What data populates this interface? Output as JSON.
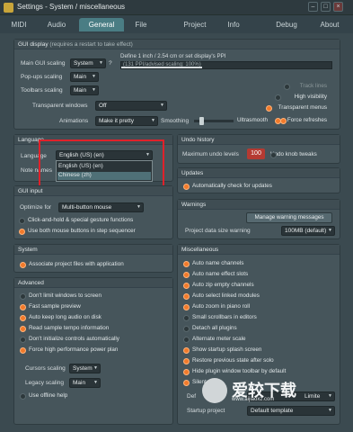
{
  "window": {
    "title": "Settings - System / miscellaneous",
    "min": "–",
    "max": "□",
    "close": "×"
  },
  "tabs": [
    "MIDI",
    "Audio",
    "General",
    "File",
    "Project",
    "Info",
    "Debug",
    "About"
  ],
  "gui_display": {
    "header": "GUI display",
    "header_note": "(requires a restart to take effect)",
    "main_gui_label": "Main GUI scaling",
    "main_gui_value": "System",
    "help": "?",
    "define_label": "Define 1 inch / 2.54 cm or set display's PPI",
    "ppi_text": "(131 PPI/advised scaling: 100%)",
    "popups_label": "Pop-ups scaling",
    "popups_value": "Main",
    "toolbars_label": "Toolbars scaling",
    "toolbars_value": "Main",
    "transparent_label": "Transparent windows",
    "transparent_value": "Off",
    "animations_label": "Animations",
    "animations_value": "Make it pretty",
    "smoothing_label": "Smoothing",
    "right_opts": [
      {
        "label": "Track lines",
        "on": false
      },
      {
        "label": "High visibility",
        "on": false
      },
      {
        "label": "Transparent menus",
        "on": true
      },
      {
        "label": "Force refreshes",
        "on": true
      }
    ],
    "ultrasmooth": {
      "label": "Ultrasmooth",
      "on": true
    }
  },
  "language": {
    "header": "Language",
    "label": "Language",
    "value": "English (US) (en)",
    "note": "Note names",
    "options": [
      "English (US) (en)",
      "Chinese (zh)"
    ]
  },
  "history": {
    "header": "Undo history",
    "max_label": "Maximum undo levels",
    "max_value": "100",
    "knob": {
      "label": "Undo knob tweaks",
      "on": false
    }
  },
  "updates": {
    "header": "Updates",
    "auto": "Automatically check for updates"
  },
  "gui_input": {
    "header": "GUI input",
    "optimize_label": "Optimize for",
    "optimize_value": "Multi-button mouse",
    "opts": [
      {
        "label": "Click-and-hold & special gesture functions",
        "on": false
      },
      {
        "label": "Use both mouse buttons in step sequencer",
        "on": true
      }
    ]
  },
  "warnings": {
    "header": "Warnings",
    "manage": "Manage warning messages",
    "limit_label": "Project data size warning",
    "limit_value": "100MB (default)"
  },
  "system": {
    "header": "System",
    "assoc": "Associate project files with application"
  },
  "advanced": {
    "header": "Advanced",
    "opts": [
      {
        "label": "Don't limit windows to screen",
        "on": false
      },
      {
        "label": "Fast sample preview",
        "on": true
      },
      {
        "label": "Auto keep long audio on disk",
        "on": true
      },
      {
        "label": "Read sample tempo information",
        "on": true
      },
      {
        "label": "Don't initialize controls automatically",
        "on": false
      },
      {
        "label": "Force high performance power plan",
        "on": true
      }
    ],
    "cursors_label": "Cursors scaling",
    "cursors_value": "System",
    "legacy_label": "Legacy scaling",
    "legacy_value": "Main",
    "offline": {
      "label": "Use offline help",
      "on": false
    }
  },
  "misc": {
    "header": "Miscellaneous",
    "opts": [
      {
        "label": "Auto name channels",
        "on": true
      },
      {
        "label": "Auto name effect slots",
        "on": true
      },
      {
        "label": "Auto zip empty channels",
        "on": true
      },
      {
        "label": "Auto select linked modules",
        "on": true
      },
      {
        "label": "Auto zoom in piano roll",
        "on": true
      },
      {
        "label": "Small scrollbars in editors",
        "on": false
      },
      {
        "label": "Detach all plugins",
        "on": false
      },
      {
        "label": "Alternate meter scale",
        "on": false
      },
      {
        "label": "Show startup splash screen",
        "on": true
      },
      {
        "label": "Restore previous state after solo",
        "on": true
      },
      {
        "label": "Hide plugin window toolbar by default",
        "on": true
      },
      {
        "label": "Silent",
        "on": true
      }
    ],
    "def_label": "Def",
    "def_value": "Limite",
    "startup_label": "Startup project",
    "startup_value": "Default template"
  },
  "watermark": {
    "main": "爱较下载",
    "sub": "www.aijiaoxz.com"
  },
  "colors": {
    "accent": "#f27a2b",
    "tab_active": "#4a7d84",
    "highlight": "#e0212a"
  }
}
